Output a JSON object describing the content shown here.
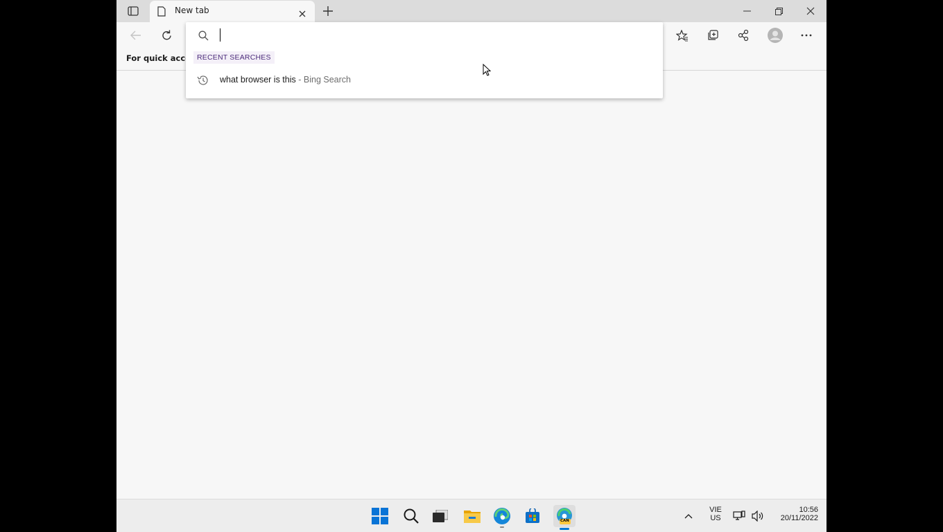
{
  "browser": {
    "tab": {
      "title": "New tab"
    },
    "favorites_bar": {
      "text": "For quick access"
    },
    "address_dropdown": {
      "input_value": "",
      "recent_header": "RECENT SEARCHES",
      "suggestions": [
        {
          "query": "what browser is this",
          "engine": " - Bing Search"
        }
      ]
    }
  },
  "taskbar": {
    "language": {
      "line1": "VIE",
      "line2": "US"
    },
    "clock": {
      "time": "10:56",
      "date": "20/11/2022"
    },
    "edge_badge": "CAN"
  },
  "colors": {
    "accent": "#0078d4",
    "recent_header": "#4b2a7a"
  }
}
